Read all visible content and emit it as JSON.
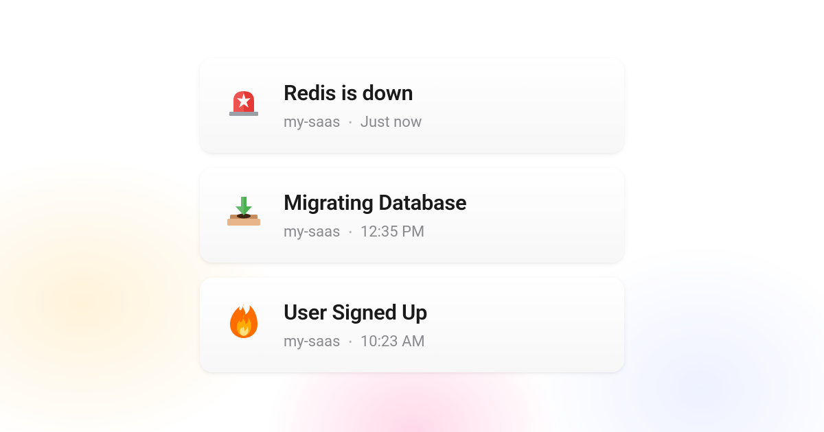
{
  "notifications": [
    {
      "icon": "siren-icon",
      "title": "Redis is down",
      "project": "my-saas",
      "time": "Just now"
    },
    {
      "icon": "inbox-download-icon",
      "title": "Migrating Database",
      "project": "my-saas",
      "time": "12:35 PM"
    },
    {
      "icon": "fire-icon",
      "title": "User Signed Up",
      "project": "my-saas",
      "time": "10:23 AM"
    }
  ]
}
